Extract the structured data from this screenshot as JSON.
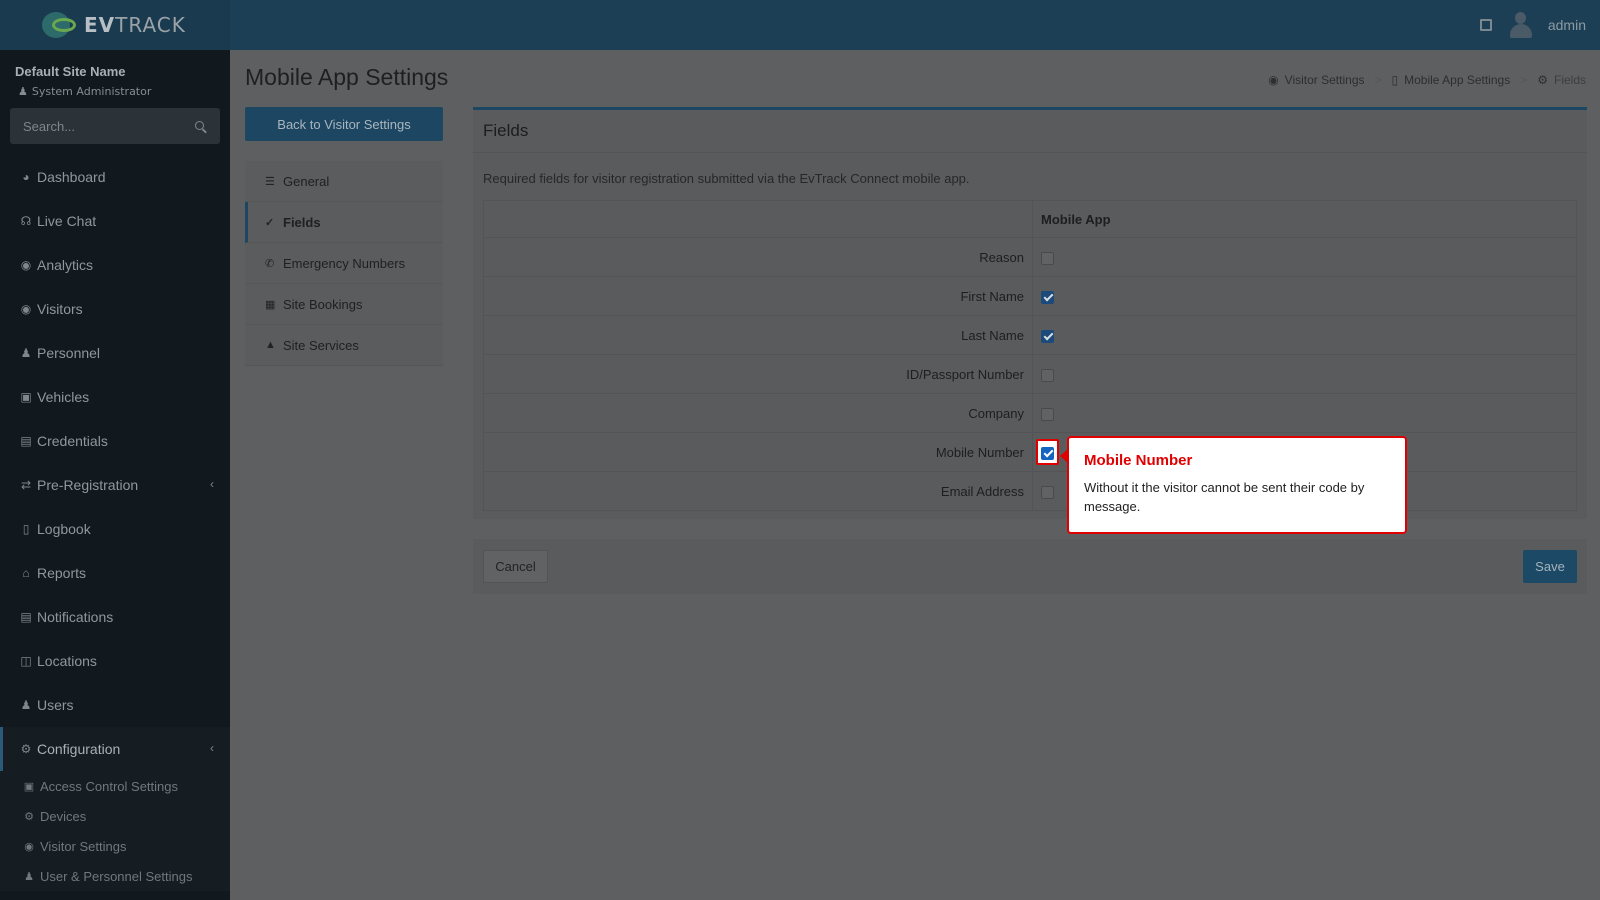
{
  "header": {
    "brand_ev": "EV",
    "brand_track": "TRACK",
    "user_name": "admin"
  },
  "sidebar": {
    "site_name": "Default Site Name",
    "role": "System Administrator",
    "search_placeholder": "Search...",
    "items": [
      {
        "label": "Dashboard",
        "icon": "dashboard-icon"
      },
      {
        "label": "Live Chat",
        "icon": "headset-icon"
      },
      {
        "label": "Analytics",
        "icon": "analytics-icon"
      },
      {
        "label": "Visitors",
        "icon": "eye-icon"
      },
      {
        "label": "Personnel",
        "icon": "personnel-icon"
      },
      {
        "label": "Vehicles",
        "icon": "car-icon"
      },
      {
        "label": "Credentials",
        "icon": "credentials-icon"
      },
      {
        "label": "Pre-Registration",
        "icon": "exchange-icon"
      },
      {
        "label": "Logbook",
        "icon": "book-icon"
      },
      {
        "label": "Reports",
        "icon": "reports-icon"
      },
      {
        "label": "Notifications",
        "icon": "chat-icon"
      },
      {
        "label": "Locations",
        "icon": "map-icon"
      },
      {
        "label": "Users",
        "icon": "users-icon"
      },
      {
        "label": "Configuration",
        "icon": "gear-icon"
      }
    ],
    "sub_items": [
      {
        "label": "Access Control Settings",
        "icon": "lock-icon"
      },
      {
        "label": "Devices",
        "icon": "devices-icon"
      },
      {
        "label": "Visitor Settings",
        "icon": "eye-icon"
      },
      {
        "label": "User & Personnel Settings",
        "icon": "users-icon"
      }
    ]
  },
  "page": {
    "title": "Mobile App Settings",
    "breadcrumb": [
      "Visitor Settings",
      "Mobile App Settings",
      "Fields"
    ],
    "back_label": "Back to Visitor Settings"
  },
  "settings_menu": [
    {
      "label": "General",
      "icon": "sliders-icon"
    },
    {
      "label": "Fields",
      "icon": "checklist-icon"
    },
    {
      "label": "Emergency Numbers",
      "icon": "phone-icon"
    },
    {
      "label": "Site Bookings",
      "icon": "calendar-icon"
    },
    {
      "label": "Site Services",
      "icon": "bell-icon"
    }
  ],
  "fields_card": {
    "title": "Fields",
    "description": "Required fields for visitor registration submitted via the EvTrack Connect mobile app.",
    "column_header": "Mobile App",
    "rows": [
      {
        "label": "Reason",
        "checked": false
      },
      {
        "label": "First Name",
        "checked": true
      },
      {
        "label": "Last Name",
        "checked": true
      },
      {
        "label": "ID/Passport Number",
        "checked": false
      },
      {
        "label": "Company",
        "checked": false
      },
      {
        "label": "Mobile Number",
        "checked": true
      },
      {
        "label": "Email Address",
        "checked": false
      }
    ]
  },
  "footer": {
    "cancel_label": "Cancel",
    "save_label": "Save"
  },
  "tooltip": {
    "title": "Mobile Number",
    "body": "Without it the visitor cannot be sent their code by message."
  },
  "colors": {
    "accent": "#1c4661",
    "highlight": "#e00000"
  }
}
